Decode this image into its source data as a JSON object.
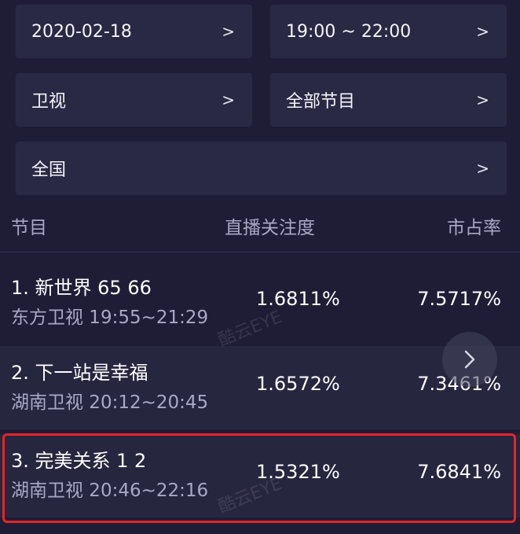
{
  "filters": {
    "date": "2020-02-18",
    "time_range": "19:00 ~ 22:00",
    "channel_type": "卫视",
    "program_type": "全部节目",
    "region": "全国",
    "arrow": ">"
  },
  "table": {
    "headers": {
      "program": "节目",
      "attention": "直播关注度",
      "share": "市占率"
    },
    "rows": [
      {
        "title": "1. 新世界 65 66",
        "subtitle": "东方卫视 19:55~21:29",
        "attention": "1.6811%",
        "share": "7.5717%"
      },
      {
        "title": "2. 下一站是幸福",
        "subtitle": "湖南卫视 20:12~20:45",
        "attention": "1.6572%",
        "share": "7.3461%"
      },
      {
        "title": "3. 完美关系 1 2",
        "subtitle": "湖南卫视 20:46~22:16",
        "attention": "1.5321%",
        "share": "7.6841%"
      }
    ]
  },
  "watermark": "酷云EYE",
  "colors": {
    "background": "#1f1d36",
    "panel": "#2a2944",
    "muted_text": "#a9a8c3",
    "highlight_border": "#e5242b"
  },
  "icons": {
    "next": "chevron-right-icon"
  }
}
